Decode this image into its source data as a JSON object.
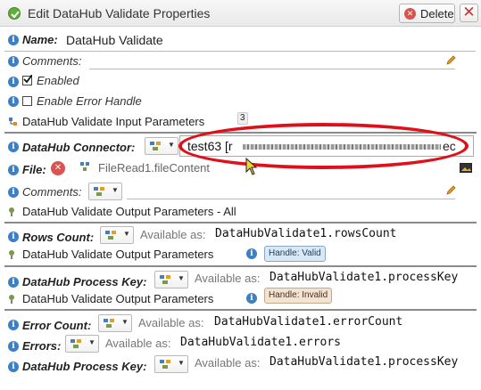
{
  "window": {
    "title": "Edit DataHub Validate Properties",
    "delete_label": "Delete",
    "close_label": "✕"
  },
  "name": {
    "label": "Name:",
    "value": "DataHub Validate"
  },
  "comments": {
    "label": "Comments:"
  },
  "enabled": {
    "label": "Enabled",
    "checked": true
  },
  "error_handle": {
    "label": "Enable Error Handle",
    "checked": false
  },
  "input_section": {
    "label": "DataHub Validate Input Parameters",
    "count": "3"
  },
  "connector": {
    "label": "DataHub Connector:",
    "value": "test63 [r",
    "value_end": "ec"
  },
  "file": {
    "label": "File:",
    "value": "FileRead1.fileContent"
  },
  "input_comments": {
    "label": "Comments:"
  },
  "output_all": {
    "label": "DataHub Validate Output Parameters - All"
  },
  "rows_count": {
    "label": "Rows Count:",
    "available_prefix": "Available as:",
    "available_value": "DataHubValidate1.rowsCount"
  },
  "output_valid": {
    "label": "DataHub Validate Output Parameters",
    "badge": "Handle: Valid"
  },
  "process_key_valid": {
    "label": "DataHub Process Key:",
    "available_prefix": "Available as:",
    "available_value": "DataHubValidate1.processKey"
  },
  "output_invalid": {
    "label": "DataHub Validate Output Parameters",
    "badge": "Handle: Invalid"
  },
  "error_count": {
    "label": "Error Count:",
    "available_prefix": "Available as:",
    "available_value": "DataHubValidate1.errorCount"
  },
  "errors": {
    "label": "Errors:",
    "available_prefix": "Available as:",
    "available_value": "DataHubValidate1.errors"
  },
  "process_key_invalid": {
    "label": "DataHub Process Key:",
    "available_prefix": "Available as:",
    "available_value": "DataHubValidate1.processKey"
  },
  "colors": {
    "accent": "#3c7fc4",
    "highlight": "#e0101a",
    "valid_badge": "#d9e8f5",
    "invalid_badge": "#f1e2d2"
  },
  "icons": [
    "check-icon",
    "delete-icon",
    "close-icon",
    "info-icon",
    "pencil-icon",
    "variable-picker-icon",
    "tree-icon"
  ]
}
